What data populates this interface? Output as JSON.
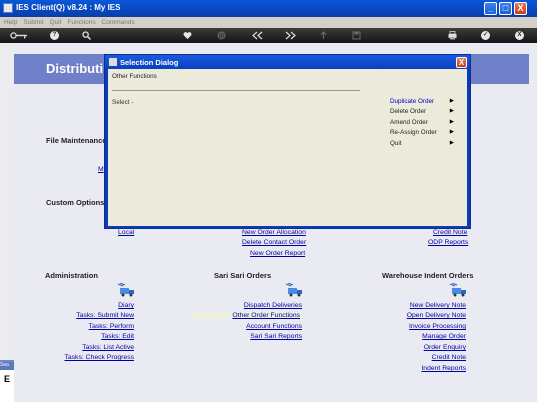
{
  "window": {
    "title": "IES Client(Q) v8.24 : My IES",
    "minimize": "_",
    "maximize": "□",
    "close": "X"
  },
  "menu": [
    "Help",
    "Submit",
    "Quit",
    "Functions",
    "Commands"
  ],
  "toolbar": {
    "icons": [
      "key-icon",
      "help-icon",
      "search-icon",
      "heart-icon",
      "refresh-icon",
      "rewind-icon",
      "forward-icon",
      "upload-icon",
      "save-icon",
      "print-icon",
      "ok-icon",
      "close-icon"
    ],
    "help": "?",
    "ok": "✓",
    "close": "X"
  },
  "banner": {
    "heading": "Distributi"
  },
  "sections": {
    "file_maintenance": "File Maintenance",
    "custom_options": "Custom Options",
    "administration": "Administration",
    "sari_sari_orders": "Sari Sari Orders",
    "warehouse_indent_orders": "Warehouse Indent Orders"
  },
  "file_maintenance_partial_link": "M",
  "custom_row": {
    "local": "Local",
    "new_order_allocation": "New Order Allocation",
    "delete_contact_order": "Delete Contact Order",
    "new_order_report": "New Order Report",
    "credit_note": "Credit Note",
    "odp_reports": "ODP Reports"
  },
  "administration_links": [
    "Diary",
    "Tasks: Submit New",
    "Tasks: Perform",
    "Tasks: Edit",
    "Tasks: List Active",
    "Tasks: Check Progress"
  ],
  "sari_links": [
    "Dispatch Deliveries",
    "Other Order Functions",
    "Account Functions",
    "Sari Sari Reports"
  ],
  "warehouse_links": [
    "New Delivery Note",
    "Open Delivery Note",
    "Invoice Processing",
    "Manage Order",
    "Order Enquiry",
    "Credit Note",
    "Indent Reports"
  ],
  "left_panel": {
    "tab": "Sea",
    "letter": "E"
  },
  "dialog": {
    "title": "Selection Dialog",
    "close": "X",
    "header": "Other Functions",
    "select_label": "Select -",
    "items": [
      {
        "label": "Duplicate Order",
        "active": true
      },
      {
        "label": "Delete Order",
        "active": false
      },
      {
        "label": "Amend Order",
        "active": false
      },
      {
        "label": "Re-Assign Order",
        "active": false
      },
      {
        "label": "Quit",
        "active": false
      }
    ],
    "arrow": "▶"
  },
  "colors": {
    "titlebar": "#0846c0",
    "banner": "#7080c8",
    "link": "#0000a0",
    "dialog_frame": "#0b3bb8",
    "dialog_body": "#eceadb"
  }
}
